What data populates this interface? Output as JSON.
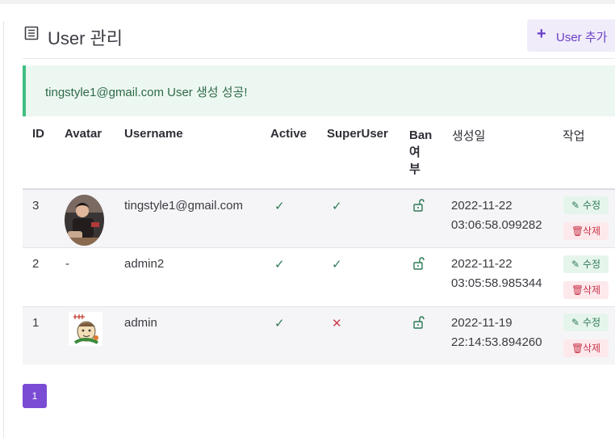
{
  "header": {
    "title": "User 관리",
    "add_button": "User 추가"
  },
  "alert": {
    "message": "tingstyle1@gmail.com User 생성 성공!"
  },
  "table": {
    "columns": [
      "ID",
      "Avatar",
      "Username",
      "Active",
      "SuperUser",
      "Ban\n여\n부",
      "생성일",
      "작업"
    ],
    "rows": [
      {
        "id": "3",
        "avatar": "photo-avatar",
        "username": "tingstyle1@gmail.com",
        "active": true,
        "superuser": true,
        "banned": false,
        "created_date": "2022-11-22",
        "created_time": "03:06:58.099282",
        "edit": "수정",
        "delete": "삭제"
      },
      {
        "id": "2",
        "avatar": "-",
        "username": "admin2",
        "active": true,
        "superuser": true,
        "banned": false,
        "created_date": "2022-11-22",
        "created_time": "03:05:58.985344",
        "edit": "수정",
        "delete": "삭제"
      },
      {
        "id": "1",
        "avatar": "cartoon-avatar",
        "username": "admin",
        "active": true,
        "superuser": false,
        "banned": false,
        "created_date": "2022-11-19",
        "created_time": "22:14:53.894260",
        "edit": "수정",
        "delete": "삭제"
      }
    ]
  },
  "pagination": {
    "current_page": "1"
  },
  "icons": {
    "title": "list-document-icon",
    "add": "plus-icon",
    "check": "check-icon",
    "cross": "x-icon",
    "unlock": "unlock-icon",
    "edit": "edit-icon",
    "delete": "trash-icon"
  },
  "colors": {
    "accent": "#7a4cd4",
    "success_bg": "#edf7f1",
    "success_border": "#3fbf7f",
    "danger": "#c93b4a"
  }
}
